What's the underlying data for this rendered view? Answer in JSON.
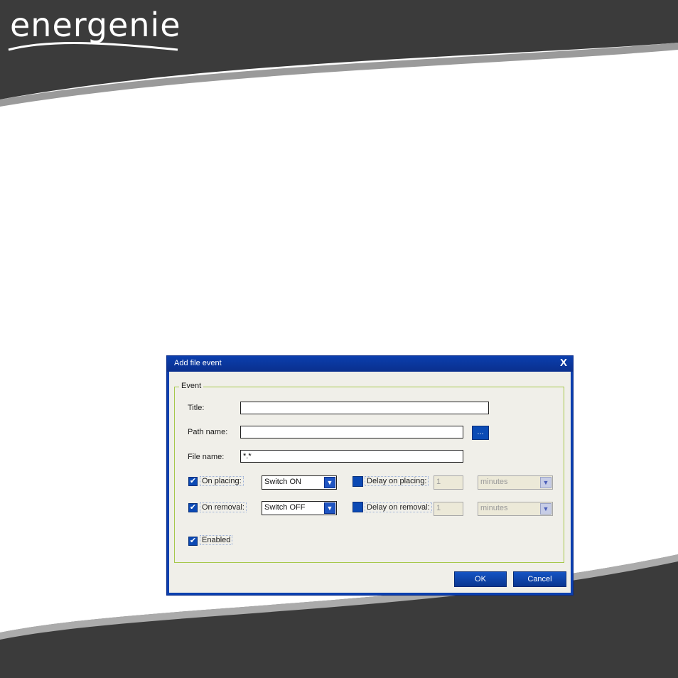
{
  "brand": {
    "logo_text": "energenie"
  },
  "dialog": {
    "title": "Add file event",
    "close_symbol": "X",
    "group_label": "Event",
    "title_label": "Title:",
    "title_value": "",
    "path_label": "Path name:",
    "path_value": "",
    "browse_label": "...",
    "file_label": "File name:",
    "file_value": "*.*",
    "on_placing": {
      "label": "On placing:",
      "checked": true,
      "action": "Switch ON"
    },
    "on_removal": {
      "label": "On removal:",
      "checked": true,
      "action": "Switch OFF"
    },
    "delay_placing": {
      "label": "Delay on placing:",
      "checked": false,
      "value": "1",
      "unit": "minutes"
    },
    "delay_removal": {
      "label": "Delay on removal:",
      "checked": false,
      "value": "1",
      "unit": "minutes"
    },
    "enabled": {
      "label": "Enabled",
      "checked": true
    },
    "ok_label": "OK",
    "cancel_label": "Cancel",
    "check_mark": "✔",
    "combo_arrow": "▼"
  },
  "colors": {
    "band": "#3a3a3a",
    "accent": "#0b3fae",
    "group_border": "#a6c84b"
  }
}
